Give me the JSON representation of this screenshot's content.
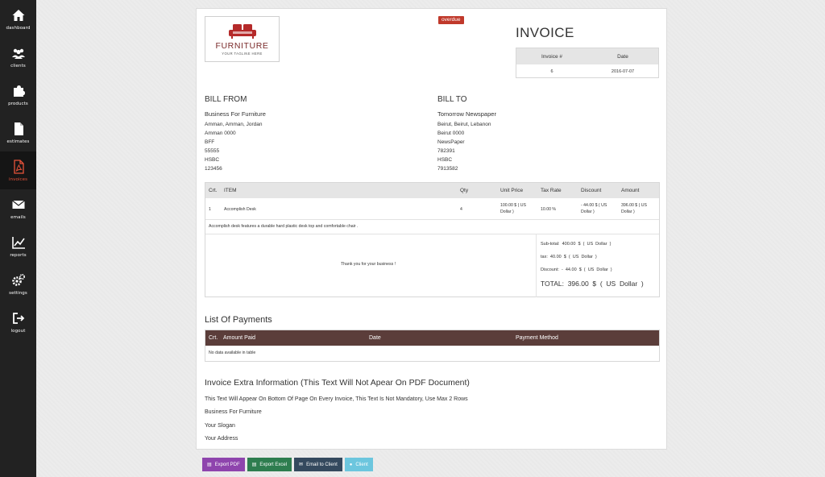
{
  "sidebar": {
    "items": [
      {
        "label": "dashboard",
        "icon": "home-icon"
      },
      {
        "label": "clients",
        "icon": "users-icon"
      },
      {
        "label": "products",
        "icon": "puzzle-icon"
      },
      {
        "label": "estimates",
        "icon": "document-icon"
      },
      {
        "label": "invoices",
        "icon": "pdf-file-icon"
      },
      {
        "label": "emails",
        "icon": "envelope-icon"
      },
      {
        "label": "reports",
        "icon": "chart-icon"
      },
      {
        "label": "settings",
        "icon": "gears-icon"
      },
      {
        "label": "logout",
        "icon": "logout-icon"
      }
    ],
    "active": "invoices",
    "active_color": "#e8533a"
  },
  "invoice": {
    "logo_brand": "FURNITURE",
    "logo_tagline": "YOUR TAGLINE HERE",
    "status_badge": "overdue",
    "title": "INVOICE",
    "meta_headers": [
      "Invoice #",
      "Date"
    ],
    "meta_values": [
      "6",
      "2016-07-07"
    ]
  },
  "bill_from": {
    "title": "BILL FROM",
    "name": "Business For Furniture",
    "lines": [
      "Amman, Amman, Jordan",
      "Amman 0000",
      "BFF",
      "55555",
      "HSBC",
      "123456"
    ]
  },
  "bill_to": {
    "title": "BILL TO",
    "name": "Tomorrow Newspaper",
    "lines": [
      "Beirut, Beirut, Lebanon",
      "Beirut 0000",
      "NewsPaper",
      "782391",
      "HSBC",
      "7913582"
    ]
  },
  "items_table": {
    "headers": [
      "Crt.",
      "ITEM",
      "Qty",
      "Unit Price",
      "Tax Rate",
      "Discount",
      "Amount"
    ],
    "rows": [
      {
        "crt": "1",
        "item": "Accomplish Desk",
        "qty": "4",
        "unit_price": "100.00 $ ( US Dollar )",
        "tax_rate": "10.00 %",
        "discount": "- 44.00 $ ( US Dollar )",
        "amount": "396.00 $ ( US Dollar )",
        "description": "Accomplish desk features a durable hard plastic desk top and comfortable chair ."
      }
    ],
    "thanks": "Thank you for your business !",
    "subtotal": "Sub-total:  400.00  $  (  US  Dollar  )",
    "tax": "tax:  40.00  $  (  US  Dollar  )",
    "discount": "Discount:  -  44.00  $  (  US  Dollar  )",
    "total": "TOTAL:  396.00  $  (  US  Dollar  )"
  },
  "payments": {
    "title": "List Of Payments",
    "headers": [
      "Crt.",
      "Amount Paid",
      "Date",
      "Payment Method"
    ],
    "empty_text": "No data available in table",
    "header_color": "#5b3d3a"
  },
  "extra": {
    "title": "Invoice Extra Information (This Text Will Not Apear On PDF Document)",
    "lines": [
      "This Text Will Appear On Bottom Of Page On Every Invoice, This Text Is Not Mandatory, Use Max 2 Rows",
      "Business For Furniture",
      "Your Slogan",
      "Your Address"
    ]
  },
  "actions": [
    {
      "label": "Export PDF",
      "icon": "file-icon",
      "color": "#8e44ad"
    },
    {
      "label": "Export Excel",
      "icon": "file-icon",
      "color": "#2e7d4f"
    },
    {
      "label": "Email to Client",
      "icon": "envelope-icon",
      "color": "#34495e"
    },
    {
      "label": "Client",
      "icon": "user-icon",
      "color": "#6cc6de"
    }
  ]
}
